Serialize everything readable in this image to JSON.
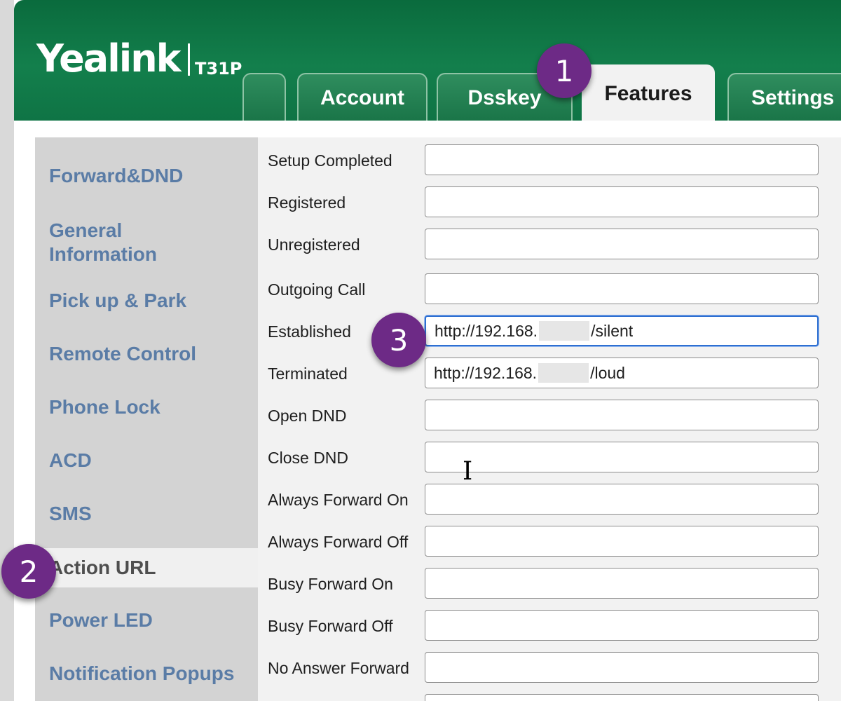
{
  "header": {
    "brand": "Yealink",
    "model": "T31P",
    "tabs": [
      {
        "label": "Account"
      },
      {
        "label": "Dsskey"
      },
      {
        "label": "Features"
      },
      {
        "label": "Settings"
      }
    ],
    "active_tab": "Features"
  },
  "sidebar": {
    "items": [
      {
        "label": "Forward&DND"
      },
      {
        "label": "General Information"
      },
      {
        "label": "Pick up & Park"
      },
      {
        "label": "Remote Control"
      },
      {
        "label": "Phone Lock"
      },
      {
        "label": "ACD"
      },
      {
        "label": "SMS"
      },
      {
        "label": "Action URL"
      },
      {
        "label": "Power LED"
      },
      {
        "label": "Notification Popups"
      }
    ],
    "active_item": "Action URL"
  },
  "form": {
    "rows": [
      {
        "label": "Setup Completed",
        "value": ""
      },
      {
        "label": "Registered",
        "value": ""
      },
      {
        "label": "Unregistered",
        "value": ""
      },
      {
        "label": "Outgoing Call",
        "value": ""
      },
      {
        "label": "Established",
        "value_prefix": "http://192.168.",
        "value_suffix": "/silent"
      },
      {
        "label": "Terminated",
        "value_prefix": "http://192.168.",
        "value_suffix": "/loud"
      },
      {
        "label": "Open DND",
        "value": ""
      },
      {
        "label": "Close DND",
        "value": ""
      },
      {
        "label": "Always Forward On",
        "value": ""
      },
      {
        "label": "Always Forward Off",
        "value": ""
      },
      {
        "label": "Busy Forward On",
        "value": ""
      },
      {
        "label": "Busy Forward Off",
        "value": ""
      },
      {
        "label": "No Answer Forward",
        "value": ""
      }
    ]
  },
  "annotations": {
    "step1": "1",
    "step2": "2",
    "step3": "3"
  },
  "colors": {
    "header_green": "#137f4c",
    "sidebar_link": "#5a7ca6",
    "badge_purple": "#6d2a86",
    "focus_blue": "#2e6fd1"
  }
}
